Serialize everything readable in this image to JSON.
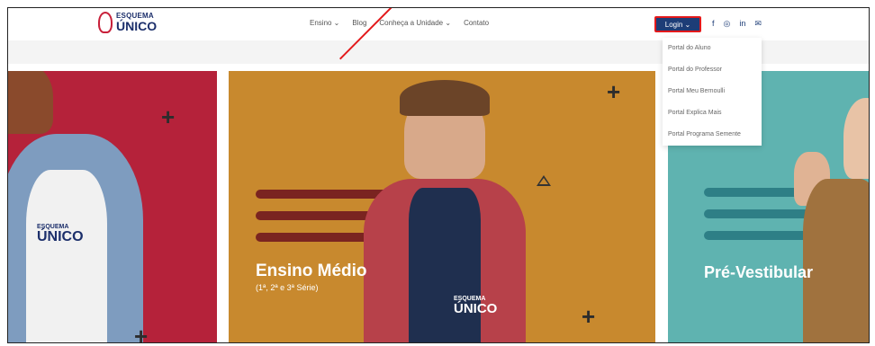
{
  "logo": {
    "top": "ESQUEMA",
    "bottom": "ÚNICO"
  },
  "nav": {
    "items": [
      "Ensino ⌄",
      "Blog",
      "Conheça a Unidade ⌄",
      "Contato"
    ]
  },
  "login": {
    "label": "Login ⌄"
  },
  "social": {
    "facebook": "f",
    "instagram": "◎",
    "linkedin": "in",
    "email": "✉"
  },
  "dropdown": {
    "items": [
      "Portal do Aluno",
      "Portal do Professor",
      "Portal Meu Bernoulli",
      "Portal Explica Mais",
      "Portal Programa Semente"
    ]
  },
  "hero": {
    "panel1": {
      "badge_top": "ESQUEMA",
      "badge_bottom": "ÚNICO"
    },
    "panel2": {
      "title": "Ensino Médio",
      "subtitle": "(1ª, 2ª e 3ª Série)",
      "badge_top": "ESQUEMA",
      "badge_bottom": "ÚNICO"
    },
    "panel3": {
      "title": "Pré-Vestibular"
    }
  },
  "colors": {
    "brand": "#1d3d77",
    "accent": "#e3191b",
    "red_panel": "#b5223a",
    "orange_panel": "#c8892e",
    "teal_panel": "#5fb3b0"
  }
}
